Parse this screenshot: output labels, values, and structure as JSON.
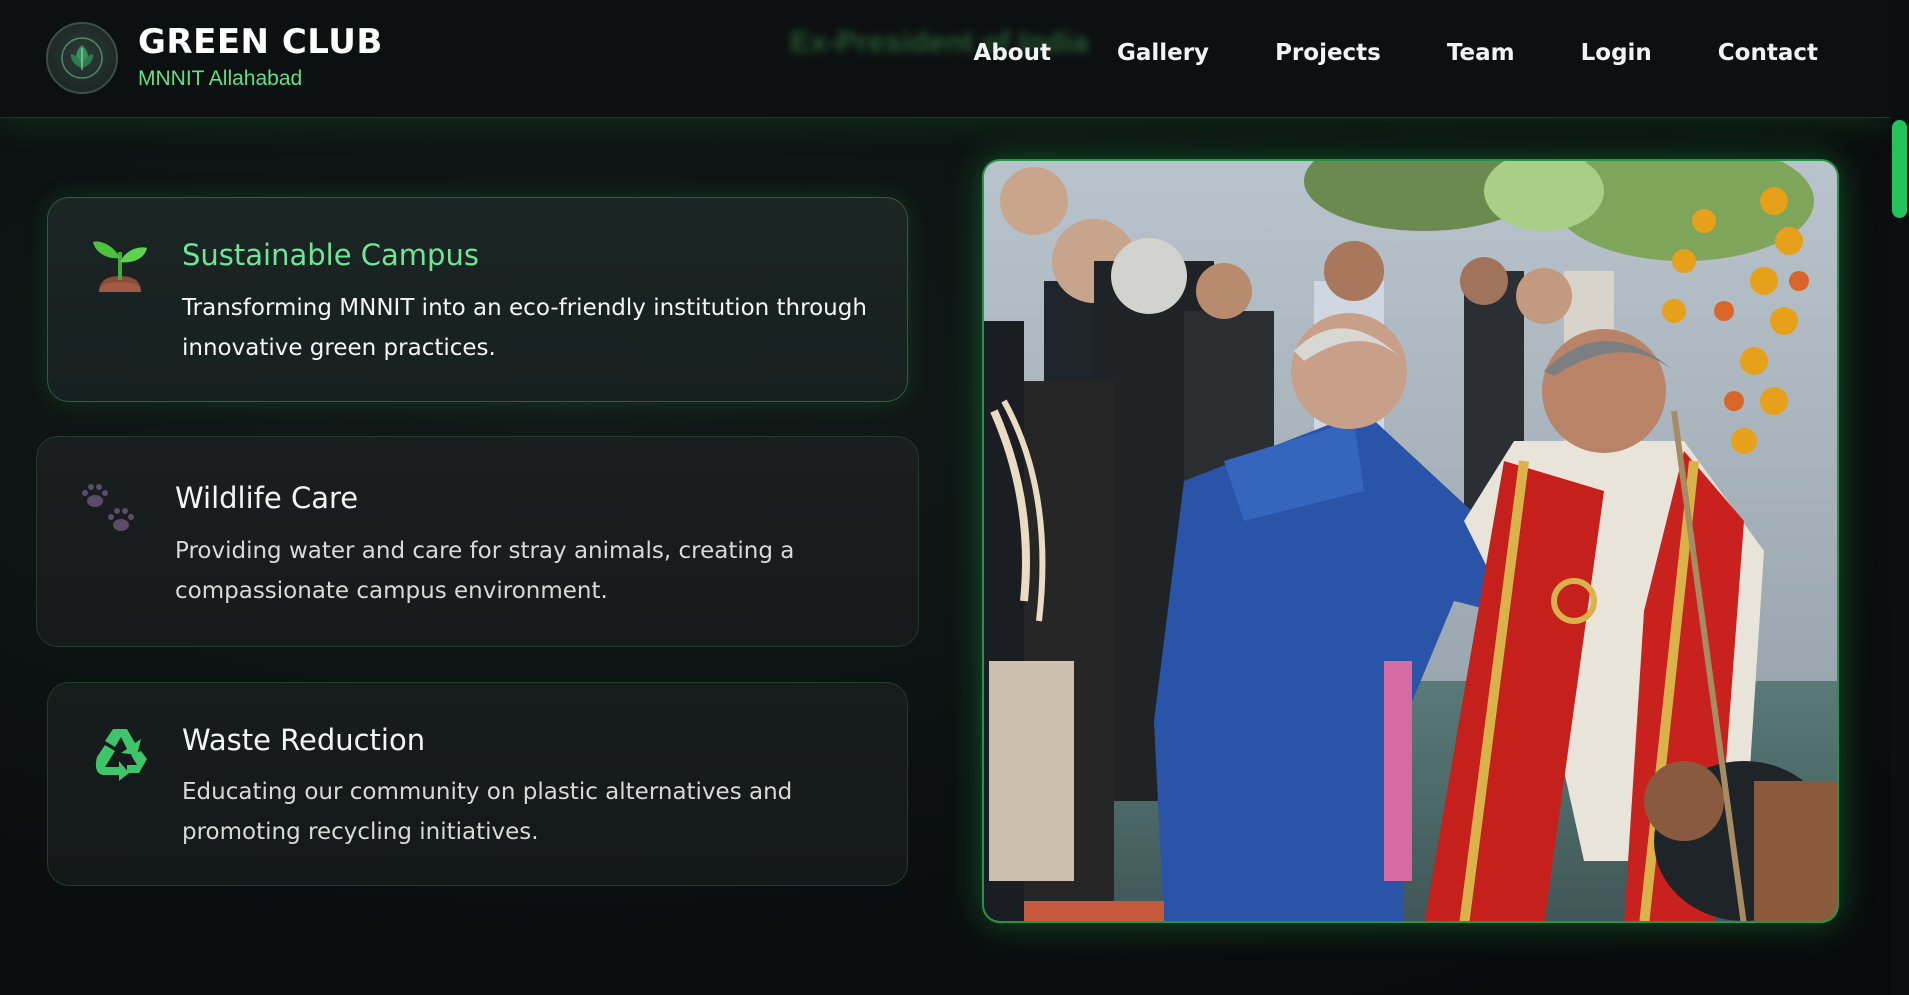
{
  "brand": {
    "title": "GREEN CLUB",
    "subtitle": "MNNIT Allahabad"
  },
  "nav": {
    "items": [
      {
        "label": "About"
      },
      {
        "label": "Gallery"
      },
      {
        "label": "Projects"
      },
      {
        "label": "Team"
      },
      {
        "label": "Login"
      },
      {
        "label": "Contact"
      }
    ]
  },
  "ghost_caption": "Ex-President of India",
  "cards": [
    {
      "icon": "seedling-icon",
      "title": "Sustainable Campus",
      "description": "Transforming MNNIT into an eco-friendly institution through innovative green practices."
    },
    {
      "icon": "paw-prints-icon",
      "title": "Wildlife Care",
      "description": "Providing water and care for stray animals, creating a compassionate campus environment."
    },
    {
      "icon": "recycle-icon",
      "title": "Waste Reduction",
      "description": "Educating our community on plastic alternatives and promoting recycling initiatives."
    }
  ],
  "colors": {
    "accent": "#5fe08a",
    "border": "#25944a",
    "background": "#0a0e0f"
  }
}
